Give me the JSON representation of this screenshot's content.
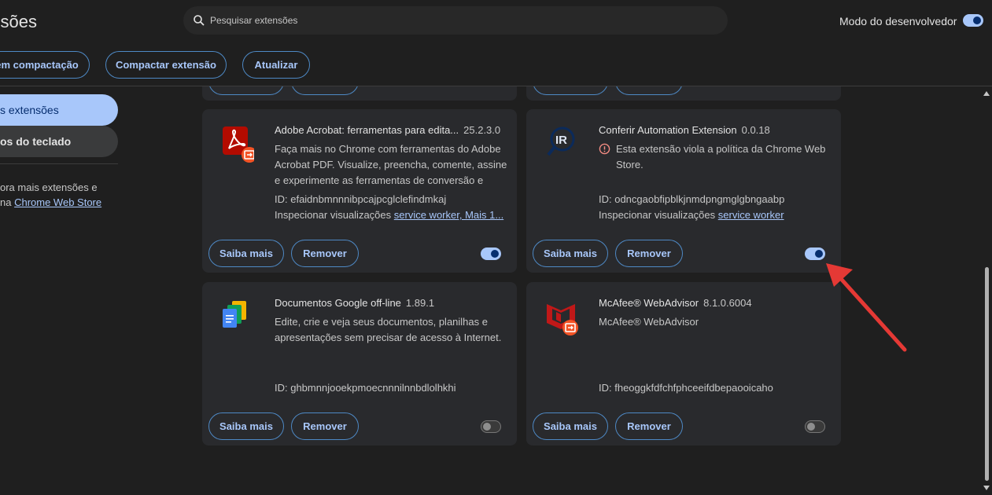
{
  "header": {
    "title": "ensões",
    "search_placeholder": "Pesquisar extensões",
    "devmode_label": "Modo do desenvolvedor",
    "devmode_on": true,
    "buttons": {
      "load_unpacked": "em compactação",
      "pack_extension": "Compactar extensão",
      "update": "Atualizar"
    }
  },
  "sidebar": {
    "active_item": "s extensões",
    "item2": "os do teclado",
    "promo_line1": "ora mais extensões e",
    "promo_line2_prefix": "na ",
    "promo_link": "Chrome Web Store"
  },
  "cards": [
    {
      "icon": "adobe-acrobat-icon",
      "name": "Adobe Acrobat: ferramentas para edita...",
      "version": "25.2.3.0",
      "description": "Faça mais no Chrome com ferramentas do Adobe Acrobat PDF. Visualize, preencha, comente, assine e experimente as ferramentas de conversão e",
      "id_text": "ID: efaidnbmnnnibpcajpcglclefindmkaj",
      "inspect_prefix": "Inspecionar visualizações",
      "inspect_links": "service worker, Mais 1...",
      "more_label": "Saiba mais",
      "remove_label": "Remover",
      "enabled": true
    },
    {
      "icon": "conferir-ir-icon",
      "name": "Conferir Automation Extension",
      "version": "0.0.18",
      "warning": "Esta extensão viola a política da Chrome Web Store.",
      "id_text": "ID: odncgaobfipblkjnmdpngmglgbngaabp",
      "inspect_prefix": "Inspecionar visualizações",
      "inspect_links": "service worker",
      "more_label": "Saiba mais",
      "remove_label": "Remover",
      "enabled": true
    },
    {
      "icon": "google-docs-offline-icon",
      "name": "Documentos Google off-line",
      "version": "1.89.1",
      "description": "Edite, crie e veja seus documentos, planilhas e apresentações sem precisar de acesso à Internet.",
      "id_text": "ID: ghbmnnjooekpmoecnnnilnnbdlolhkhi",
      "more_label": "Saiba mais",
      "remove_label": "Remover",
      "enabled": false
    },
    {
      "icon": "mcafee-icon",
      "name": "McAfee® WebAdvisor",
      "version": "8.1.0.6004",
      "description": "McAfee® WebAdvisor",
      "id_text": "ID: fheoggkfdfchfphceeifdbepaooicaho",
      "more_label": "Saiba mais",
      "remove_label": "Remover",
      "enabled": false
    }
  ],
  "colors": {
    "accent": "#a8c7fa",
    "annotation_arrow": "#e53935",
    "warning": "#f28b82"
  }
}
